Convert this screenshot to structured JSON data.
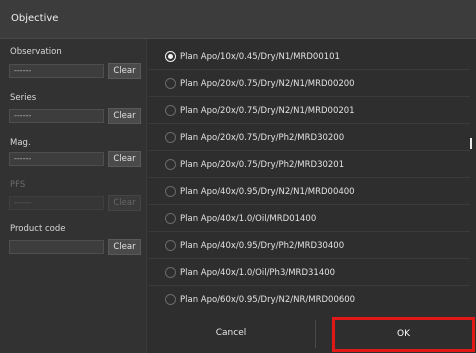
{
  "window": {
    "title": "Objective"
  },
  "filters": [
    {
      "label": "Observation",
      "value": "------",
      "clear_label": "Clear",
      "disabled": false
    },
    {
      "label": "Series",
      "value": "------",
      "clear_label": "Clear",
      "disabled": false
    },
    {
      "label": "Mag.",
      "value": "------",
      "clear_label": "Clear",
      "disabled": false
    },
    {
      "label": "PFS",
      "value": "------",
      "clear_label": "Clear",
      "disabled": true
    },
    {
      "label": "Product code",
      "value": "",
      "clear_label": "Clear",
      "disabled": false
    }
  ],
  "options": [
    {
      "label": "Plan Apo/10x/0.45/Dry/N1/MRD00101",
      "selected": true
    },
    {
      "label": "Plan Apo/20x/0.75/Dry/N2/N1/MRD00200",
      "selected": false
    },
    {
      "label": "Plan Apo/20x/0.75/Dry/N2/N1/MRD00201",
      "selected": false
    },
    {
      "label": "Plan Apo/20x/0.75/Dry/Ph2/MRD30200",
      "selected": false
    },
    {
      "label": "Plan Apo/20x/0.75/Dry/Ph2/MRD30201",
      "selected": false
    },
    {
      "label": "Plan Apo/40x/0.95/Dry/N2/N1/MRD00400",
      "selected": false
    },
    {
      "label": "Plan Apo/40x/1.0/Oil/MRD01400",
      "selected": false
    },
    {
      "label": "Plan Apo/40x/0.95/Dry/Ph2/MRD30400",
      "selected": false
    },
    {
      "label": "Plan Apo/40x/1.0/Oil/Ph3/MRD31400",
      "selected": false
    },
    {
      "label": "Plan Apo/60x/0.95/Dry/N2/NR/MRD00600",
      "selected": false
    }
  ],
  "footer": {
    "cancel_label": "Cancel",
    "ok_label": "OK"
  },
  "colors": {
    "highlight": "#e01818",
    "background": "#2e2e2e"
  }
}
